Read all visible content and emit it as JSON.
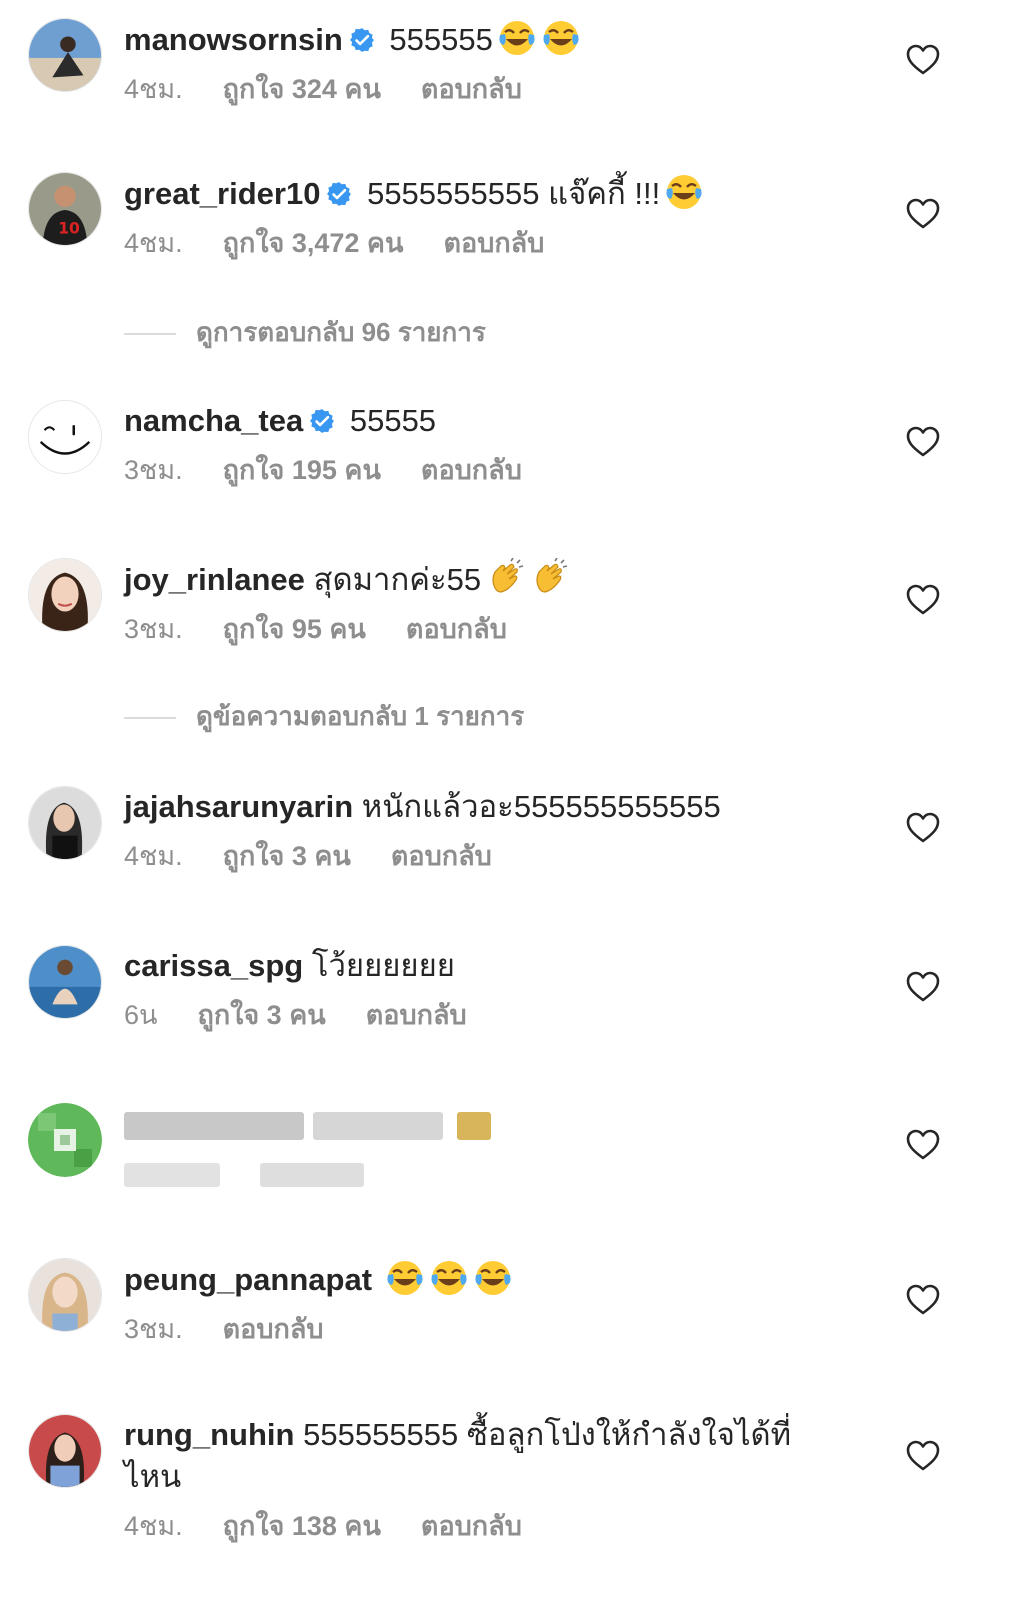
{
  "comments": [
    {
      "username": "manowsornsin",
      "verified": true,
      "text": "555555",
      "emojis": 2,
      "time": "4ชม.",
      "likes": "ถูกใจ 324 คน",
      "reply": "ตอบกลับ"
    },
    {
      "username": "great_rider10",
      "verified": true,
      "text": "5555555555 แจ๊คกี้ !!!",
      "emojis": 1,
      "time": "4ชม.",
      "likes": "ถูกใจ 3,472 คน",
      "reply": "ตอบกลับ"
    },
    {
      "username": "namcha_tea",
      "verified": true,
      "text": "55555",
      "emojis": 0,
      "time": "3ชม.",
      "likes": "ถูกใจ 195 คน",
      "reply": "ตอบกลับ"
    },
    {
      "username": "joy_rinlanee",
      "verified": false,
      "text": "สุดมากค่ะ55",
      "emojis": 2,
      "time": "3ชม.",
      "likes": "ถูกใจ 95 คน",
      "reply": "ตอบกลับ"
    },
    {
      "username": "jajahsarunyarin",
      "verified": false,
      "text": "หนักแล้วอะ555555555555",
      "emojis": 0,
      "time": "4ชม.",
      "likes": "ถูกใจ 3 คน",
      "reply": "ตอบกลับ"
    },
    {
      "username": "carissa_spg",
      "verified": false,
      "text": "โว้ยยยยยย",
      "emojis": 0,
      "time": "6น",
      "likes": "ถูกใจ 3 คน",
      "reply": "ตอบกลับ"
    },
    {
      "username": "peung_pannapat",
      "verified": false,
      "text": "",
      "emojis": 3,
      "time": "3ชม.",
      "likes": "",
      "reply": "ตอบกลับ"
    },
    {
      "username": "rung_nuhin",
      "verified": false,
      "text": "555555555 ซื้อลูกโป่งให้กำลังใจได้ที่ไหน",
      "emojis": 0,
      "time": "4ชม.",
      "likes": "ถูกใจ 138 คน",
      "reply": "ตอบกลับ"
    }
  ],
  "view_replies": [
    {
      "label": "ดูการตอบกลับ 96 รายการ"
    },
    {
      "label": "ดูข้อความตอบกลับ 1 รายการ"
    }
  ],
  "icons": {
    "verified": "verified-badge-icon",
    "like": "heart-outline-icon",
    "laugh": "face-with-tears-of-joy-icon",
    "clap": "clapping-hands-icon"
  },
  "colors": {
    "text": "#262626",
    "secondary": "#8e8e8e",
    "verified": "#3897f0",
    "divider": "#dbdbdb"
  }
}
